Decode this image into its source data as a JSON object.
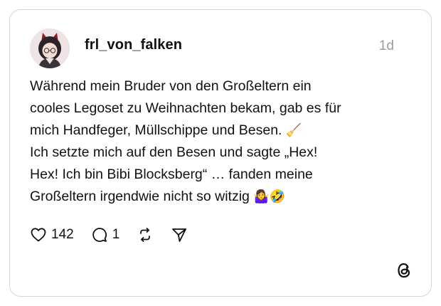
{
  "post": {
    "username": "frl_von_falken",
    "timestamp": "1d",
    "lines": [
      "Während mein Bruder von den Großeltern ein",
      "cooles Legoset zu Weihnachten bekam, gab es für",
      "mich Handfeger, Müllschippe und Besen.",
      "Ich setzte mich auf den Besen und sagte „Hex!",
      "Hex! Ich bin Bibi Blocksberg“ … fanden meine",
      "Großeltern irgendwie nicht so witzig"
    ],
    "emoji_line3": "🧹",
    "emoji_line6": "🤷‍♀️🤣"
  },
  "actions": {
    "likes": "142",
    "replies": "1"
  },
  "icons": {
    "like": "heart-icon",
    "reply": "comment-icon",
    "repost": "repost-icon",
    "share": "send-icon",
    "brand": "threads-logo-icon"
  },
  "colors": {
    "border": "#d6d6d6",
    "timestamp": "#9a9a9a",
    "text": "#111111"
  }
}
